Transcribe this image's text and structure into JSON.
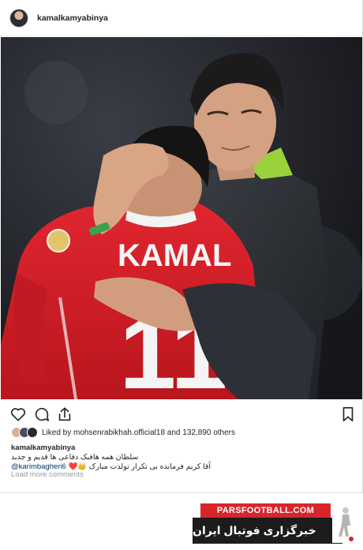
{
  "post": {
    "username": "kamalkamyabinya",
    "photo": {
      "jersey_text": "KAMAL",
      "jersey_number": "11",
      "alt": "post-photo"
    },
    "actions": {
      "like_icon": "heart-outline-icon",
      "comment_icon": "comment-bubble-icon",
      "share_icon": "share-arrow-icon",
      "save_icon": "bookmark-icon"
    },
    "likes": {
      "text": "Liked by mohsenrabikhah.official18 and 132,890 others"
    },
    "caption": {
      "username": "kamalkamyabinya",
      "line1": "سلطان همه هافبک دفاعی ها قدیم و جدید",
      "line2": "آقا کریم فرمانده بی تکرار تولدت مبارک",
      "mention": "@karimbagheri6",
      "emoji": "❤️👑"
    },
    "load_more": "Load more comments"
  },
  "watermark": {
    "site": "PARSFOOTBALL.COM",
    "tagline": "خبرگزاری فوتبال ایران"
  },
  "colors": {
    "brand_red": "#d7262b",
    "brand_dark": "#1c1c1c",
    "jersey_red": "#d4212a",
    "mention": "#003569"
  }
}
